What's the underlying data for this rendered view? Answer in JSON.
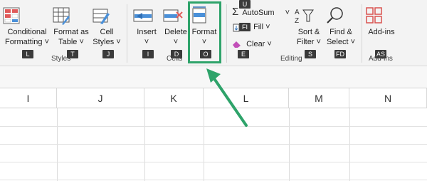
{
  "ribbon": {
    "styles": {
      "conditional": {
        "line1": "Conditional",
        "line2": "Formatting ˅",
        "key": "L"
      },
      "format_table": {
        "line1": "Format as",
        "line2": "Table ˅",
        "key": "T"
      },
      "cell_styles": {
        "line1": "Cell",
        "line2": "Styles ˅",
        "key": "J"
      },
      "title": "Styles"
    },
    "cells": {
      "insert": {
        "label": "Insert",
        "chev": "˅",
        "key": "I"
      },
      "delete": {
        "label": "Delete",
        "chev": "˅",
        "key": "D"
      },
      "format": {
        "label": "Format",
        "chev": "˅",
        "key": "O"
      },
      "title": "Cells"
    },
    "editing": {
      "autosum": {
        "label": "AutoSum",
        "chev": "˅",
        "key": "U"
      },
      "fill": {
        "label": "Fill ˅",
        "key": "FI"
      },
      "clear": {
        "label": "Clear ˅",
        "key": "E"
      },
      "sort_filter": {
        "line1": "Sort &",
        "line2": "Filter ˅",
        "key": "S"
      },
      "find_select": {
        "line1": "Find &",
        "line2": "Select ˅",
        "key": "FD"
      },
      "title": "Editing"
    },
    "addins": {
      "addins": {
        "label": "Add-ins",
        "key": "AS"
      },
      "title": "Add-ins"
    }
  },
  "columns": [
    "I",
    "J",
    "K",
    "L",
    "M",
    "N"
  ],
  "colors": {
    "accent_green": "#2ea36a",
    "ribbon_bg": "#f3f3f3",
    "key_bg": "#3a3a3a"
  }
}
